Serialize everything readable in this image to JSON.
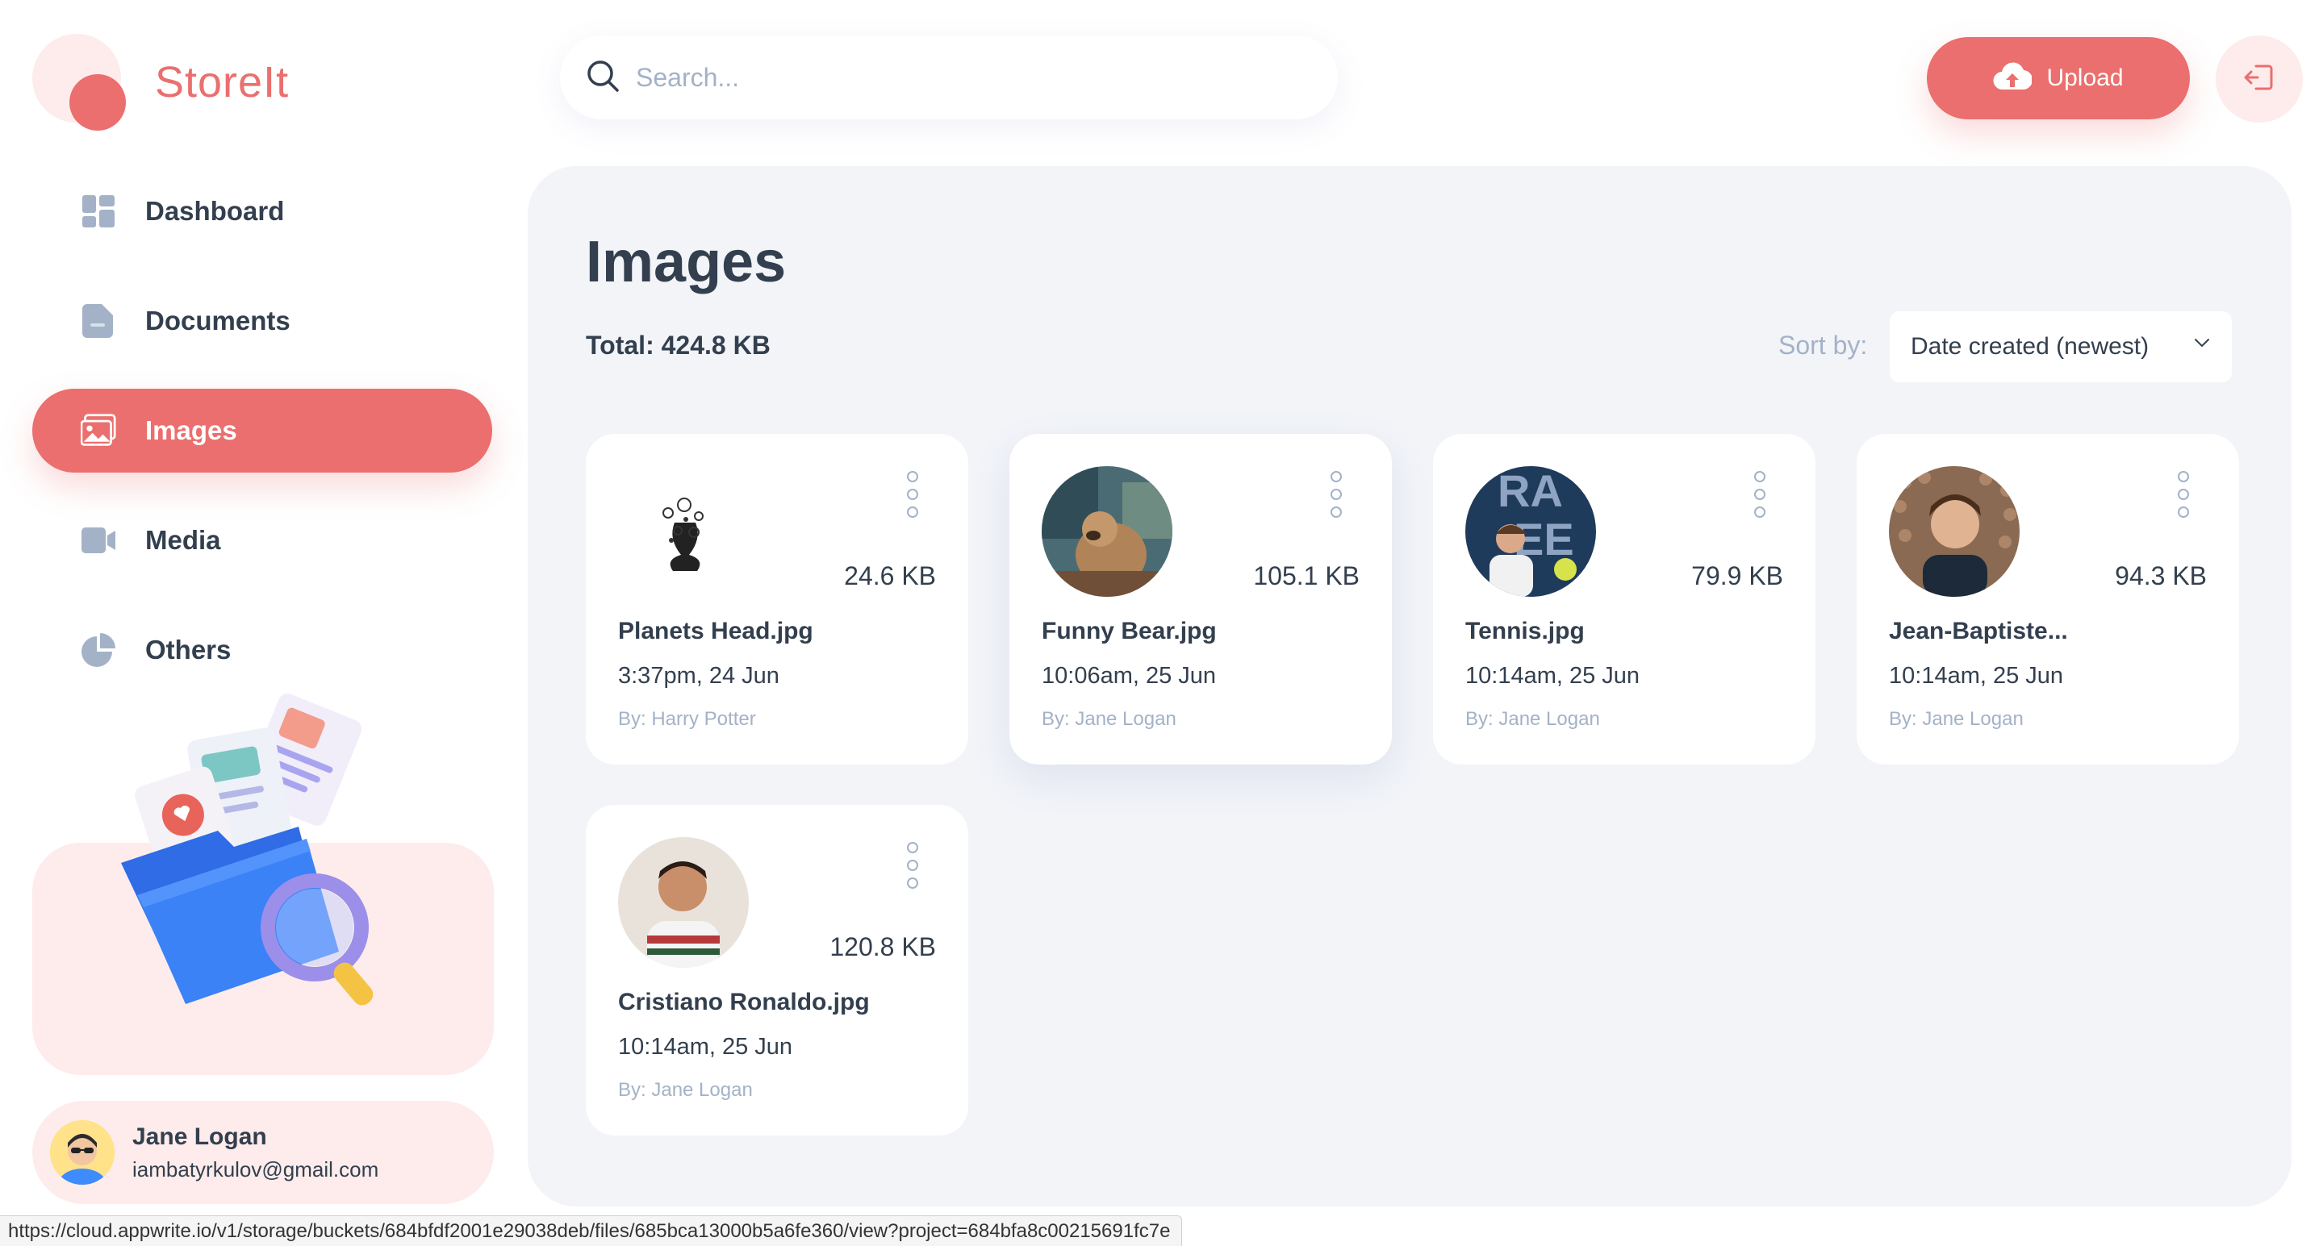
{
  "app": {
    "name": "StoreIt",
    "brand_color": "#EA6F6E"
  },
  "sidebar": {
    "items": [
      {
        "label": "Dashboard",
        "icon": "dashboard-icon",
        "active": false
      },
      {
        "label": "Documents",
        "icon": "document-icon",
        "active": false
      },
      {
        "label": "Images",
        "icon": "images-icon",
        "active": true
      },
      {
        "label": "Media",
        "icon": "video-icon",
        "active": false
      },
      {
        "label": "Others",
        "icon": "pie-chart-icon",
        "active": false
      }
    ]
  },
  "user": {
    "name": "Jane Logan",
    "email": "iambatyrkulov@gmail.com"
  },
  "header": {
    "search_placeholder": "Search...",
    "upload_label": "Upload"
  },
  "main": {
    "title": "Images",
    "total_label": "Total:",
    "total_value": "424.8 KB",
    "sort_label": "Sort by:",
    "sort_value": "Date created (newest)"
  },
  "files": [
    {
      "name": "Planets Head.jpg",
      "size": "24.6 KB",
      "date": "3:37pm, 24 Jun",
      "by": "By: Harry Potter"
    },
    {
      "name": "Funny Bear.jpg",
      "size": "105.1 KB",
      "date": "10:06am, 25 Jun",
      "by": "By: Jane Logan"
    },
    {
      "name": "Tennis.jpg",
      "size": "79.9 KB",
      "date": "10:14am, 25 Jun",
      "by": "By: Jane Logan"
    },
    {
      "name": "Jean-Baptiste...",
      "size": "94.3 KB",
      "date": "10:14am, 25 Jun",
      "by": "By: Jane Logan"
    },
    {
      "name": "Cristiano Ronaldo.jpg",
      "size": "120.8 KB",
      "date": "10:14am, 25 Jun",
      "by": "By: Jane Logan"
    }
  ],
  "status_bar": {
    "url": "https://cloud.appwrite.io/v1/storage/buckets/684bfdf2001e29038deb/files/685bca13000b5a6fe360/view?project=684bfa8c00215691fc7e"
  }
}
